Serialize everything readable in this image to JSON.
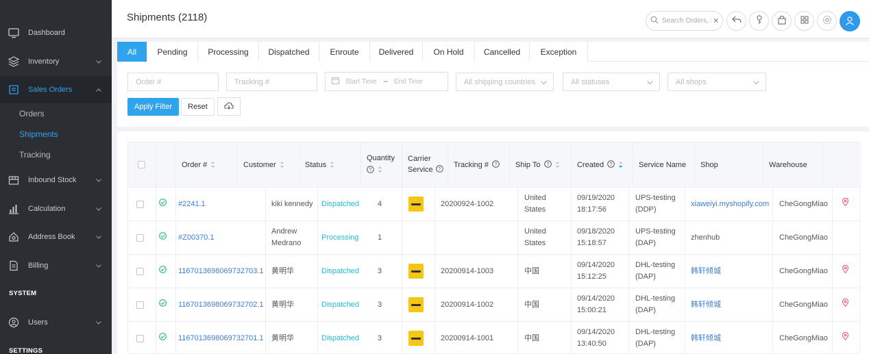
{
  "sidebar": {
    "items": [
      {
        "label": "Dashboard",
        "icon": "dashboard-icon"
      },
      {
        "label": "Inventory",
        "icon": "box-icon"
      },
      {
        "label": "Sales Orders",
        "icon": "orders-icon"
      },
      {
        "label": "Inbound Stock",
        "icon": "inbound-icon"
      },
      {
        "label": "Calculation",
        "icon": "chart-icon"
      },
      {
        "label": "Address Book",
        "icon": "address-icon"
      },
      {
        "label": "Billing",
        "icon": "billing-icon"
      },
      {
        "label": "Users",
        "icon": "users-icon"
      }
    ],
    "sub_items": [
      "Orders",
      "Shipments",
      "Tracking"
    ],
    "section_system": "SYSTEM",
    "section_settings": "SETTINGS"
  },
  "header": {
    "title": "Shipments (2118)",
    "search_placeholder": "Search Orders, S"
  },
  "tabs": [
    "All",
    "Pending",
    "Processing",
    "Dispatched",
    "Enroute",
    "Delivered",
    "On Hold",
    "Cancelled",
    "Exception"
  ],
  "filters": {
    "order_placeholder": "Order #",
    "tracking_placeholder": "Tracking #",
    "start_time": "Start Time",
    "range_sep": "–",
    "end_time": "End Time",
    "countries": "All shipping countries",
    "statuses": "All statuses",
    "shops": "All shops",
    "apply": "Apply Filter",
    "reset": "Reset"
  },
  "table": {
    "headers": {
      "order": "Order #",
      "customer": "Customer",
      "status": "Status",
      "quantity": "Quantity",
      "carrier_1": "Carrier",
      "carrier_2": "Service",
      "tracking": "Tracking #",
      "ship_to": "Ship To",
      "created": "Created",
      "service_name": "Service Name",
      "shop": "Shop",
      "warehouse": "Warehouse"
    },
    "rows": [
      {
        "order": "#2241.1",
        "customer": "kiki kennedy",
        "customer2": "",
        "status": "Dispatched",
        "qty": "4",
        "tracking": "20200924-1002",
        "ship_to": "United",
        "ship_to2": "States",
        "created": "09/19/2020",
        "created2": "18:17:56",
        "service": "UPS-testing",
        "service2": "(DDP)",
        "shop": "xiaweiyi.myshopify.com",
        "warehouse": "CheGongMiao"
      },
      {
        "order": "#Z00370.1",
        "customer": "Andrew",
        "customer2": "Medrano",
        "status": "Processing",
        "qty": "1",
        "tracking": "",
        "ship_to": "United",
        "ship_to2": "States",
        "created": "09/18/2020",
        "created2": "15:18:57",
        "service": "UPS-testing",
        "service2": "(DAP)",
        "shop": "zhenhub",
        "warehouse": "CheGongMiao"
      },
      {
        "order": "1167013698069732703.1",
        "customer": "黄明华",
        "customer2": "",
        "status": "Dispatched",
        "qty": "3",
        "tracking": "20200914-1003",
        "ship_to": "中国",
        "ship_to2": "",
        "created": "09/14/2020",
        "created2": "15:12:25",
        "service": "DHL-testing",
        "service2": "(DAP)",
        "shop": "韩轩倾城",
        "warehouse": "CheGongMiao"
      },
      {
        "order": "1167013698069732702.1",
        "customer": "黄明华",
        "customer2": "",
        "status": "Dispatched",
        "qty": "3",
        "tracking": "20200914-1002",
        "ship_to": "中国",
        "ship_to2": "",
        "created": "09/14/2020",
        "created2": "15:00:21",
        "service": "DHL-testing",
        "service2": "(DAP)",
        "shop": "韩轩倾城",
        "warehouse": "CheGongMiao"
      },
      {
        "order": "1167013698069732701.1",
        "customer": "黄明华",
        "customer2": "",
        "status": "Dispatched",
        "qty": "3",
        "tracking": "20200914-1001",
        "ship_to": "中国",
        "ship_to2": "",
        "created": "09/14/2020",
        "created2": "13:40:50",
        "service": "DHL-testing",
        "service2": "(DAP)",
        "shop": "韩轩倾城",
        "warehouse": "CheGongMiao"
      }
    ]
  }
}
